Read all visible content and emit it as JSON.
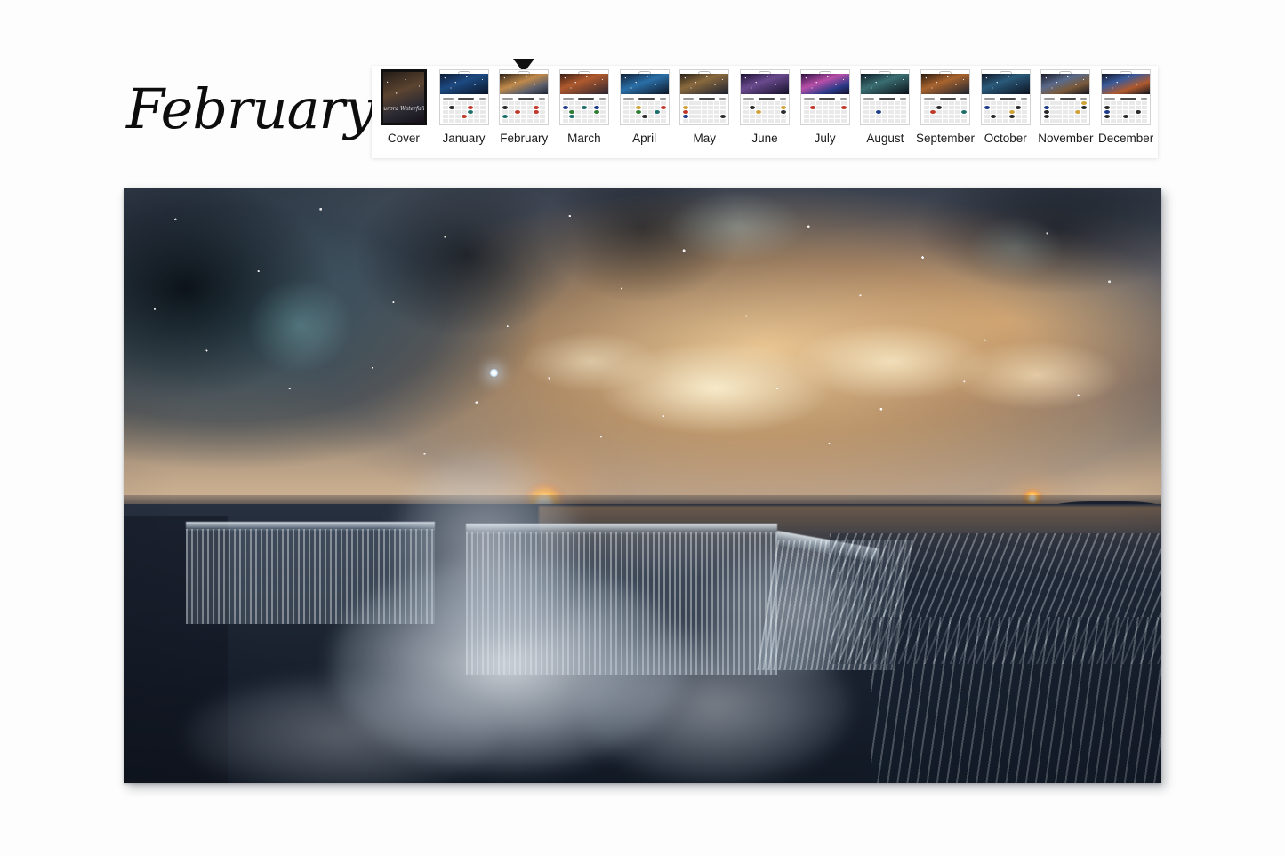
{
  "page": {
    "background_color": "#fdfdfd",
    "title_text": "February"
  },
  "preview": {
    "name": "calendar-page-preview",
    "selected_month": "February",
    "scene_description": "Milky Way galaxy over Niagara-style horseshoe waterfall at night",
    "colors": {
      "sky_warm": "#f0c896",
      "sky_dark": "#39424f",
      "water_dark": "#18202d",
      "foam_white": "#e4eaf0",
      "sun_glow": "#ffb347"
    }
  },
  "thumbnail_strip": {
    "name": "month-thumbnail-strip",
    "selected_index": 2,
    "items": [
      {
        "label": "Cover",
        "type": "cover",
        "selected": false,
        "dots": []
      },
      {
        "label": "January",
        "type": "month",
        "selected": false,
        "dots": [
          {
            "i": 8,
            "c": "dot-k"
          },
          {
            "i": 11,
            "c": "dot-r"
          },
          {
            "i": 18,
            "c": "dot-t"
          },
          {
            "i": 24,
            "c": "dot-r"
          }
        ]
      },
      {
        "label": "February",
        "type": "month",
        "selected": true,
        "dots": [
          {
            "i": 7,
            "c": "dot-k"
          },
          {
            "i": 12,
            "c": "dot-r"
          },
          {
            "i": 16,
            "c": "dot-r"
          },
          {
            "i": 19,
            "c": "dot-r"
          },
          {
            "i": 21,
            "c": "dot-t"
          }
        ]
      },
      {
        "label": "March",
        "type": "month",
        "selected": false,
        "dots": [
          {
            "i": 7,
            "c": "dot-b"
          },
          {
            "i": 10,
            "c": "dot-t"
          },
          {
            "i": 12,
            "c": "dot-b"
          },
          {
            "i": 15,
            "c": "dot-g"
          },
          {
            "i": 19,
            "c": "dot-g"
          },
          {
            "i": 22,
            "c": "dot-t"
          }
        ]
      },
      {
        "label": "April",
        "type": "month",
        "selected": false,
        "dots": [
          {
            "i": 9,
            "c": "dot"
          },
          {
            "i": 13,
            "c": "dot-r"
          },
          {
            "i": 16,
            "c": "dot-g"
          },
          {
            "i": 19,
            "c": "dot-t"
          },
          {
            "i": 24,
            "c": "dot-k"
          }
        ]
      },
      {
        "label": "May",
        "type": "month",
        "selected": false,
        "dots": [
          {
            "i": 7,
            "c": "dot"
          },
          {
            "i": 14,
            "c": "dot-r"
          },
          {
            "i": 21,
            "c": "dot-b"
          },
          {
            "i": 27,
            "c": "dot-k"
          }
        ]
      },
      {
        "label": "June",
        "type": "month",
        "selected": false,
        "dots": [
          {
            "i": 8,
            "c": "dot-k"
          },
          {
            "i": 13,
            "c": "dot"
          },
          {
            "i": 16,
            "c": "dot"
          },
          {
            "i": 20,
            "c": "dot-k"
          }
        ]
      },
      {
        "label": "July",
        "type": "month",
        "selected": false,
        "dots": [
          {
            "i": 8,
            "c": "dot-r"
          },
          {
            "i": 13,
            "c": "dot-r"
          }
        ]
      },
      {
        "label": "August",
        "type": "month",
        "selected": false,
        "dots": [
          {
            "i": 16,
            "c": "dot-b"
          }
        ]
      },
      {
        "label": "September",
        "type": "month",
        "selected": false,
        "dots": [
          {
            "i": 9,
            "c": "dot-k"
          },
          {
            "i": 15,
            "c": "dot-r"
          },
          {
            "i": 20,
            "c": "dot-t"
          }
        ]
      },
      {
        "label": "October",
        "type": "month",
        "selected": false,
        "dots": [
          {
            "i": 7,
            "c": "dot-b"
          },
          {
            "i": 12,
            "c": "dot-k"
          },
          {
            "i": 18,
            "c": "dot"
          },
          {
            "i": 22,
            "c": "dot-k"
          },
          {
            "i": 25,
            "c": "dot-k"
          }
        ]
      },
      {
        "label": "November",
        "type": "month",
        "selected": false,
        "dots": [
          {
            "i": 7,
            "c": "dot-b"
          },
          {
            "i": 13,
            "c": "dot-k"
          },
          {
            "i": 14,
            "c": "dot-k"
          },
          {
            "i": 6,
            "c": "dot"
          },
          {
            "i": 21,
            "c": "dot-k"
          },
          {
            "i": 19,
            "c": "dot"
          }
        ]
      },
      {
        "label": "December",
        "type": "month",
        "selected": false,
        "dots": [
          {
            "i": 7,
            "c": "dot-k"
          },
          {
            "i": 14,
            "c": "dot-b"
          },
          {
            "i": 19,
            "c": "dot-k"
          },
          {
            "i": 21,
            "c": "dot-k"
          },
          {
            "i": 24,
            "c": "dot-k"
          }
        ]
      }
    ],
    "cover_signature": "Aurora Waterfalls"
  }
}
